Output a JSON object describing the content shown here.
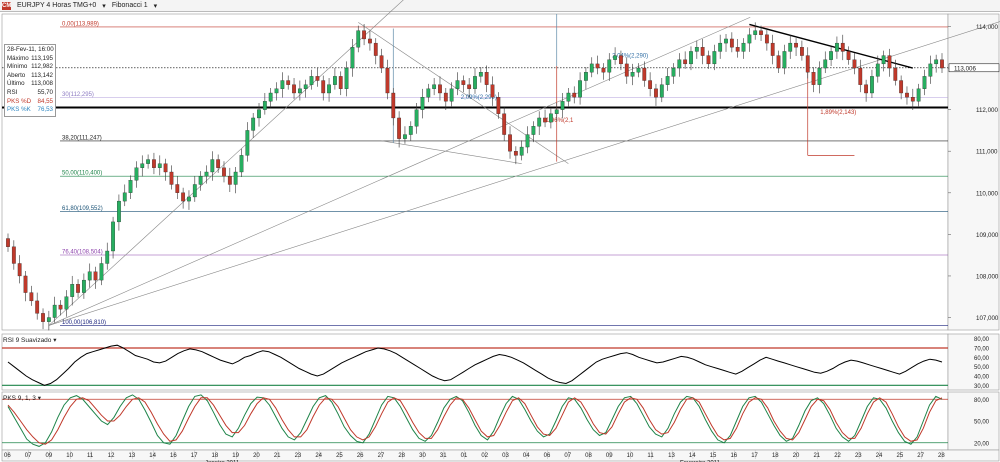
{
  "header": {
    "logo_text": "CM",
    "symbol": "EURJPY 4 Horas TMG+0",
    "dropdown_icon": "chevron-down-icon",
    "study": "Fibonacci 1"
  },
  "info": {
    "date": "28-Fev-11, 16:00",
    "rows": [
      {
        "label": "Máximo",
        "value": "113,195"
      },
      {
        "label": "Mínimo",
        "value": "112,982"
      },
      {
        "label": "Aberto",
        "value": "113,142"
      },
      {
        "label": "Último",
        "value": "113,008"
      },
      {
        "label": "RSI",
        "value": "55,70"
      },
      {
        "label": "PKS %D",
        "value": "84,55",
        "color": "#c0392b"
      },
      {
        "label": "PKS %K",
        "value": "76,53",
        "color": "#2e86c1"
      }
    ]
  },
  "rsi_label": "RSI 9 Suavizado",
  "pks_label": "PKS 9, 1, 3",
  "chart_data": [
    {
      "type": "candlestick",
      "title": "EURJPY 4 Horas TMG+0",
      "ylim": [
        106.7,
        114.3
      ],
      "yticks": [
        "114,000",
        "113,000",
        "112,000",
        "111,000",
        "110,000",
        "109,000",
        "108,000",
        "107,000"
      ],
      "last_price_label": "113,006",
      "fib_levels": [
        {
          "label": "0,00(113,989)",
          "value": 113.989,
          "color": "#c0392b"
        },
        {
          "label": "38,20(111,247)",
          "value": 111.247,
          "color": "#222222"
        },
        {
          "label": "50,00(110,400)",
          "value": 110.4,
          "color": "#1e8449"
        },
        {
          "label": "61,80(109,552)",
          "value": 109.552,
          "color": "#1a5276"
        },
        {
          "label": "76,40(108,504)",
          "value": 108.504,
          "color": "#8e44ad"
        },
        {
          "label": "100,00(106,810)",
          "value": 106.81,
          "color": "#1a237e"
        }
      ],
      "extra_levels": [
        {
          "label": "30(112,295)",
          "value": 112.295
        },
        {
          "label": "",
          "value": 112.05,
          "style": "thick"
        }
      ],
      "annotations": [
        {
          "text": "2,09%(2,299)",
          "x": 0.485,
          "y": 112.25
        },
        {
          "text": "2,04%(2,290)",
          "x": 0.645,
          "y": 113.25
        },
        {
          "text": "1,96%(2,1",
          "x": 0.575,
          "y": 111.7
        },
        {
          "text": "1,89%(2,143)",
          "x": 0.865,
          "y": 111.9
        }
      ],
      "x_day_labels": [
        "06",
        "07",
        "09",
        "10",
        "11",
        "12",
        "13",
        "14",
        "16",
        "17",
        "18",
        "19",
        "20",
        "21",
        "23",
        "24",
        "25",
        "26",
        "27",
        "28",
        "30",
        "31",
        "01",
        "02",
        "03",
        "04",
        "06",
        "07",
        "08",
        "09",
        "10",
        "11",
        "13",
        "14",
        "15",
        "16",
        "17",
        "18",
        "20",
        "21",
        "22",
        "23",
        "24",
        "25",
        "27",
        "28"
      ],
      "month_labels": [
        "Janeiro 2011",
        "Fevereiro 2011"
      ],
      "up_color": "#27ae60",
      "down_color": "#c0392b",
      "closes": [
        108.7,
        108.3,
        108.0,
        107.6,
        107.4,
        107.1,
        106.9,
        107.0,
        107.3,
        107.2,
        107.5,
        107.8,
        107.6,
        107.9,
        108.1,
        107.9,
        108.3,
        108.6,
        109.3,
        109.8,
        110.0,
        110.3,
        110.6,
        110.7,
        110.8,
        110.6,
        110.7,
        110.5,
        110.2,
        110.0,
        109.8,
        109.9,
        110.2,
        110.4,
        110.5,
        110.8,
        110.6,
        110.4,
        110.2,
        110.5,
        110.9,
        111.5,
        111.8,
        112.0,
        112.2,
        112.4,
        112.5,
        112.7,
        112.6,
        112.4,
        112.5,
        112.6,
        112.8,
        112.7,
        112.4,
        112.6,
        112.8,
        112.5,
        113.0,
        113.5,
        113.9,
        113.7,
        113.6,
        113.3,
        113.0,
        112.4,
        111.8,
        111.3,
        111.4,
        111.6,
        112.0,
        112.3,
        112.5,
        112.6,
        112.4,
        112.2,
        112.5,
        112.7,
        112.6,
        112.5,
        112.8,
        112.9,
        112.6,
        112.3,
        111.9,
        111.4,
        111.0,
        110.9,
        111.1,
        111.4,
        111.6,
        111.8,
        111.7,
        111.9,
        112.0,
        112.2,
        112.4,
        112.3,
        112.7,
        112.9,
        113.1,
        113.0,
        112.9,
        113.2,
        113.3,
        113.1,
        112.8,
        112.9,
        113.0,
        112.7,
        112.5,
        112.3,
        112.6,
        112.8,
        113.0,
        113.2,
        113.1,
        113.4,
        113.5,
        113.3,
        113.1,
        113.4,
        113.6,
        113.7,
        113.5,
        113.4,
        113.6,
        113.8,
        113.9,
        113.8,
        113.6,
        113.3,
        113.0,
        113.4,
        113.6,
        113.5,
        113.3,
        112.9,
        112.6,
        113.0,
        113.2,
        113.4,
        113.6,
        113.4,
        113.2,
        113.0,
        112.6,
        112.4,
        112.8,
        113.1,
        113.3,
        113.0,
        112.7,
        112.4,
        112.3,
        112.2,
        112.5,
        112.8,
        113.1,
        113.2,
        113.0
      ]
    },
    {
      "type": "line",
      "title": "RSI 9 Suavizado",
      "ylim": [
        25,
        85
      ],
      "yticks": [
        "80,00",
        "70,00",
        "60,00",
        "50,00",
        "40,00",
        "30,00"
      ],
      "levels": [
        {
          "value": 70,
          "color": "#c0392b"
        },
        {
          "value": 30,
          "color": "#1e8449"
        }
      ],
      "values": [
        55,
        50,
        45,
        40,
        36,
        33,
        30,
        32,
        36,
        42,
        48,
        55,
        60,
        64,
        66,
        68,
        70,
        72,
        73,
        70,
        66,
        62,
        60,
        58,
        55,
        54,
        56,
        60,
        64,
        67,
        69,
        68,
        66,
        63,
        60,
        57,
        55,
        53,
        56,
        60,
        62,
        65,
        67,
        66,
        63,
        60,
        56,
        52,
        48,
        45,
        42,
        40,
        42,
        46,
        50,
        54,
        57,
        60,
        63,
        66,
        68,
        70,
        69,
        67,
        64,
        60,
        56,
        52,
        48,
        44,
        40,
        37,
        35,
        36,
        40,
        44,
        48,
        52,
        55,
        58,
        61,
        63,
        62,
        60,
        57,
        54,
        50,
        46,
        42,
        38,
        35,
        33,
        32,
        35,
        40,
        45,
        50,
        55,
        58,
        60,
        62,
        64,
        65,
        63,
        60,
        58,
        56,
        54,
        55,
        57,
        59,
        61,
        60,
        58,
        55,
        52,
        50,
        48,
        46,
        44,
        42,
        45,
        49,
        53,
        57,
        60,
        58,
        56,
        54,
        52,
        50,
        48,
        46,
        44,
        43,
        45,
        48,
        52,
        55,
        57,
        56,
        54,
        52,
        50,
        48,
        46,
        44,
        42,
        45,
        49,
        53,
        56,
        58,
        57,
        55
      ]
    },
    {
      "type": "line",
      "title": "PKS 9, 1, 3",
      "ylim": [
        10,
        90
      ],
      "yticks": [
        "80,00",
        "50,00",
        "20,00"
      ],
      "levels": [
        {
          "value": 80,
          "color": "#c0392b"
        },
        {
          "value": 20,
          "color": "#1e8449"
        }
      ],
      "series": [
        {
          "name": "PKS %K",
          "color": "#1e8449",
          "values": [
            70,
            55,
            40,
            25,
            18,
            15,
            20,
            35,
            55,
            72,
            82,
            85,
            80,
            70,
            60,
            50,
            45,
            55,
            70,
            82,
            86,
            80,
            65,
            48,
            30,
            20,
            18,
            30,
            50,
            70,
            84,
            86,
            78,
            62,
            45,
            32,
            28,
            40,
            58,
            74,
            83,
            82,
            72,
            56,
            40,
            28,
            24,
            34,
            52,
            70,
            82,
            85,
            76,
            60,
            42,
            30,
            22,
            20,
            32,
            52,
            72,
            84,
            82,
            70,
            54,
            38,
            26,
            22,
            30,
            48,
            68,
            80,
            84,
            78,
            62,
            44,
            30,
            24,
            36,
            56,
            74,
            84,
            80,
            66,
            50,
            36,
            28,
            32,
            50,
            70,
            82,
            80,
            68,
            52,
            38,
            30,
            34,
            52,
            70,
            82,
            84,
            74,
            58,
            42,
            32,
            28,
            40,
            60,
            76,
            84,
            82,
            70,
            52,
            36,
            24,
            20,
            30,
            50,
            70,
            82,
            84,
            76,
            60,
            44,
            30,
            22,
            26,
            44,
            64,
            78,
            82,
            74,
            58,
            40,
            28,
            22,
            30,
            50,
            70,
            82,
            80,
            68,
            50,
            34,
            22,
            18,
            28,
            50,
            72,
            84,
            80
          ]
        },
        {
          "name": "PKS %D",
          "color": "#c0392b",
          "values": [
            72,
            62,
            50,
            38,
            28,
            20,
            18,
            24,
            38,
            55,
            70,
            80,
            82,
            78,
            68,
            58,
            50,
            50,
            58,
            70,
            80,
            82,
            76,
            62,
            46,
            32,
            22,
            24,
            36,
            54,
            70,
            82,
            82,
            72,
            58,
            44,
            34,
            34,
            44,
            60,
            74,
            82,
            80,
            68,
            52,
            38,
            28,
            28,
            38,
            56,
            72,
            82,
            80,
            70,
            54,
            38,
            28,
            24,
            28,
            42,
            60,
            76,
            82,
            78,
            64,
            48,
            34,
            26,
            26,
            38,
            56,
            72,
            82,
            80,
            68,
            52,
            36,
            28,
            30,
            44,
            62,
            78,
            82,
            74,
            58,
            42,
            32,
            30,
            40,
            58,
            76,
            82,
            76,
            62,
            46,
            34,
            32,
            42,
            60,
            76,
            82,
            80,
            68,
            52,
            38,
            32,
            34,
            48,
            66,
            80,
            82,
            76,
            60,
            44,
            30,
            24,
            26,
            40,
            60,
            76,
            82,
            80,
            68,
            50,
            36,
            26,
            24,
            34,
            52,
            70,
            80,
            78,
            66,
            48,
            34,
            26,
            26,
            40,
            60,
            76,
            82,
            76,
            60,
            42,
            28,
            22,
            24,
            40,
            62,
            78,
            82
          ]
        }
      ]
    }
  ]
}
